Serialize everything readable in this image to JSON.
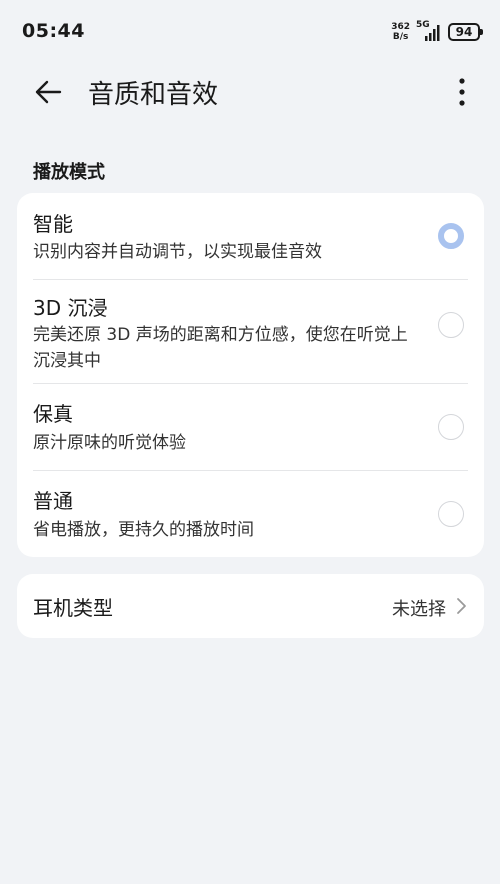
{
  "status_bar": {
    "time": "05:44",
    "net_speed_value": "362",
    "net_speed_unit": "B/s",
    "network_type": "5G",
    "battery": "94"
  },
  "header": {
    "title": "音质和音效"
  },
  "playback_mode": {
    "section_title": "播放模式",
    "options": [
      {
        "title": "智能",
        "desc": "识别内容并自动调节，以实现最佳音效",
        "selected": true
      },
      {
        "title": "3D 沉浸",
        "desc": "完美还原 3D 声场的距离和方位感，使您在听觉上沉浸其中",
        "selected": false
      },
      {
        "title": "保真",
        "desc": "原汁原味的听觉体验",
        "selected": false
      },
      {
        "title": "普通",
        "desc": "省电播放，更持久的播放时间",
        "selected": false
      }
    ]
  },
  "headphone": {
    "label": "耳机类型",
    "value": "未选择"
  },
  "colors": {
    "background": "#f1f3f6",
    "card": "#ffffff",
    "radio_selected": "#a9c3ef"
  },
  "icons": {
    "back": "arrow-left-icon",
    "more": "more-vertical-icon",
    "chevron": "chevron-right-icon"
  }
}
